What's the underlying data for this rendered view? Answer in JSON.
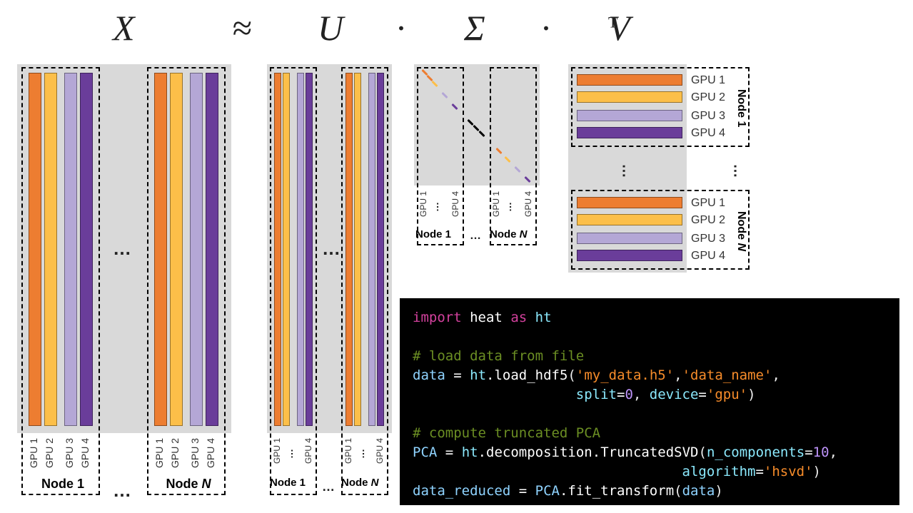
{
  "equation": {
    "X": "X",
    "approx": "≈",
    "U": "U",
    "dot1": "·",
    "Sigma": "Σ",
    "dot2": "·",
    "V": "V",
    "T": "T"
  },
  "matrices": {
    "X": {
      "node1": {
        "label": "Node 1",
        "gpus": [
          "GPU 1",
          "GPU 2",
          "GPU 3",
          "GPU 4"
        ]
      },
      "ellipsis": "…",
      "nodeN": {
        "label": "Node N",
        "gpus": [
          "GPU 1",
          "GPU 2",
          "GPU 3",
          "GPU 4"
        ]
      }
    },
    "U": {
      "node1": {
        "label": "Node 1",
        "gpus": [
          "GPU 1",
          "GPU 4"
        ]
      },
      "ellipsis": "…",
      "nodeN": {
        "label": "Node N",
        "gpus": [
          "GPU 1",
          "GPU 4"
        ]
      }
    },
    "Sigma": {
      "node1": {
        "label": "Node 1",
        "gpus": [
          "GPU 1",
          "GPU 4"
        ]
      },
      "ellipsis": "…",
      "nodeN": {
        "label": "Node N",
        "gpus": [
          "GPU 1",
          "GPU 4"
        ]
      }
    },
    "Vt": {
      "node1": {
        "label": "Node 1",
        "gpus": [
          "GPU 1",
          "GPU 2",
          "GPU 3",
          "GPU 4"
        ]
      },
      "vdots_left": "⋮",
      "vdots_right": "⋮",
      "nodeN": {
        "label": "Node N",
        "gpus": [
          "GPU 1",
          "GPU 2",
          "GPU 3",
          "GPU 4"
        ]
      }
    }
  },
  "colors": {
    "c1": "#ed7d31",
    "c2": "#fcbf49",
    "c3": "#b4a7d6",
    "c4": "#6a3d9a"
  },
  "code": {
    "import": "import",
    "heat": "heat",
    "as": "as",
    "ht": "ht",
    "comment_load": "# load data from file",
    "data": "data",
    "load_fn": "load_hdf5",
    "file_arg": "'my_data.h5'",
    "dset_arg": "'data_name'",
    "split_kw": "split",
    "split_val": "0",
    "device_kw": "device",
    "device_val": "'gpu'",
    "comment_pca": "# compute truncated PCA",
    "PCA": "PCA",
    "decomp": "decomposition",
    "trsvd": "TruncatedSVD",
    "ncomp_kw": "n_components",
    "ncomp_val": "10",
    "algo_kw": "algorithm",
    "algo_val": "'hsvd'",
    "data_reduced": "data_reduced",
    "fit": "fit_transform"
  }
}
